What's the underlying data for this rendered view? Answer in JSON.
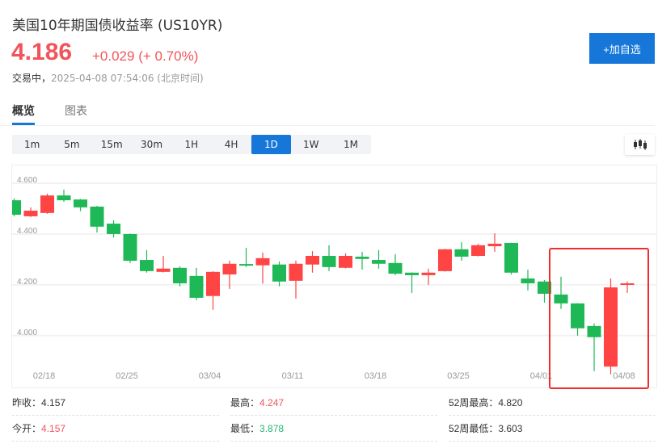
{
  "header": {
    "title": "美国10年期国债收益率  (US10YR)",
    "price": "4.186",
    "change": "+0.029 (+ 0.70%)",
    "status_label": "交易中，",
    "timestamp": "2025-04-08 07:54:06",
    "timezone": "(北京时间)",
    "add_watchlist_label": "+加自选"
  },
  "tabs": [
    {
      "label": "概览",
      "active": true
    },
    {
      "label": "图表",
      "active": false
    }
  ],
  "periods": [
    {
      "label": "1m"
    },
    {
      "label": "5m"
    },
    {
      "label": "15m"
    },
    {
      "label": "30m"
    },
    {
      "label": "1H"
    },
    {
      "label": "4H"
    },
    {
      "label": "1D",
      "active": true
    },
    {
      "label": "1W"
    },
    {
      "label": "1M"
    }
  ],
  "toolbar": {
    "chart_type_icon": "candlestick-icon"
  },
  "colors": {
    "up": "#ff4444",
    "down": "#1fb856",
    "accent": "#1677d9",
    "highlight": "#f22b2b"
  },
  "chart_data": {
    "type": "candlestick",
    "ylim": [
      3.85,
      4.67
    ],
    "y_ticks": [
      "4.600",
      "4.400",
      "4.200",
      "4.000"
    ],
    "x_ticks": [
      "02/18",
      "02/25",
      "03/04",
      "03/11",
      "03/18",
      "03/25",
      "04/01",
      "04/08"
    ],
    "grid": true,
    "candles": [
      {
        "date": "02/13",
        "o": 4.533,
        "h": 4.54,
        "l": 4.47,
        "c": 4.476
      },
      {
        "date": "02/14",
        "o": 4.47,
        "h": 4.505,
        "l": 4.467,
        "c": 4.492
      },
      {
        "date": "02/18",
        "o": 4.483,
        "h": 4.559,
        "l": 4.48,
        "c": 4.552
      },
      {
        "date": "02/19",
        "o": 4.552,
        "h": 4.575,
        "l": 4.527,
        "c": 4.533
      },
      {
        "date": "02/20",
        "o": 4.536,
        "h": 4.538,
        "l": 4.49,
        "c": 4.505
      },
      {
        "date": "02/21",
        "o": 4.508,
        "h": 4.511,
        "l": 4.406,
        "c": 4.429
      },
      {
        "date": "02/24",
        "o": 4.441,
        "h": 4.454,
        "l": 4.387,
        "c": 4.4
      },
      {
        "date": "02/25",
        "o": 4.4,
        "h": 4.402,
        "l": 4.286,
        "c": 4.295
      },
      {
        "date": "02/26",
        "o": 4.298,
        "h": 4.337,
        "l": 4.248,
        "c": 4.254
      },
      {
        "date": "02/27",
        "o": 4.251,
        "h": 4.314,
        "l": 4.249,
        "c": 4.264
      },
      {
        "date": "02/28",
        "o": 4.267,
        "h": 4.273,
        "l": 4.194,
        "c": 4.206
      },
      {
        "date": "03/03",
        "o": 4.235,
        "h": 4.267,
        "l": 4.14,
        "c": 4.149
      },
      {
        "date": "03/04",
        "o": 4.156,
        "h": 4.254,
        "l": 4.102,
        "c": 4.251
      },
      {
        "date": "03/05",
        "o": 4.241,
        "h": 4.295,
        "l": 4.184,
        "c": 4.283
      },
      {
        "date": "03/06",
        "o": 4.282,
        "h": 4.346,
        "l": 4.27,
        "c": 4.276
      },
      {
        "date": "03/07",
        "o": 4.277,
        "h": 4.327,
        "l": 4.205,
        "c": 4.305
      },
      {
        "date": "03/10",
        "o": 4.28,
        "h": 4.292,
        "l": 4.194,
        "c": 4.213
      },
      {
        "date": "03/11",
        "o": 4.216,
        "h": 4.295,
        "l": 4.146,
        "c": 4.283
      },
      {
        "date": "03/12",
        "o": 4.28,
        "h": 4.333,
        "l": 4.248,
        "c": 4.314
      },
      {
        "date": "03/13",
        "o": 4.314,
        "h": 4.356,
        "l": 4.254,
        "c": 4.27
      },
      {
        "date": "03/14",
        "o": 4.267,
        "h": 4.324,
        "l": 4.265,
        "c": 4.314
      },
      {
        "date": "03/17",
        "o": 4.311,
        "h": 4.33,
        "l": 4.26,
        "c": 4.302
      },
      {
        "date": "03/18",
        "o": 4.298,
        "h": 4.337,
        "l": 4.264,
        "c": 4.283
      },
      {
        "date": "03/19",
        "o": 4.286,
        "h": 4.321,
        "l": 4.238,
        "c": 4.244
      },
      {
        "date": "03/20",
        "o": 4.248,
        "h": 4.249,
        "l": 4.168,
        "c": 4.238
      },
      {
        "date": "03/21",
        "o": 4.238,
        "h": 4.264,
        "l": 4.2,
        "c": 4.248
      },
      {
        "date": "03/24",
        "o": 4.254,
        "h": 4.342,
        "l": 4.252,
        "c": 4.34
      },
      {
        "date": "03/25",
        "o": 4.34,
        "h": 4.368,
        "l": 4.295,
        "c": 4.311
      },
      {
        "date": "03/26",
        "o": 4.314,
        "h": 4.362,
        "l": 4.312,
        "c": 4.356
      },
      {
        "date": "03/27",
        "o": 4.352,
        "h": 4.403,
        "l": 4.33,
        "c": 4.362
      },
      {
        "date": "03/28",
        "o": 4.365,
        "h": 4.366,
        "l": 4.241,
        "c": 4.248
      },
      {
        "date": "03/31",
        "o": 4.225,
        "h": 4.26,
        "l": 4.178,
        "c": 4.206
      },
      {
        "date": "04/01",
        "o": 4.213,
        "h": 4.219,
        "l": 4.13,
        "c": 4.165
      },
      {
        "date": "04/02",
        "o": 4.162,
        "h": 4.232,
        "l": 4.105,
        "c": 4.127
      },
      {
        "date": "04/03",
        "o": 4.127,
        "h": 4.128,
        "l": 4.0,
        "c": 4.029
      },
      {
        "date": "04/04",
        "o": 4.038,
        "h": 4.048,
        "l": 3.86,
        "c": 3.994
      },
      {
        "date": "04/07",
        "o": 3.878,
        "h": 4.225,
        "l": 3.848,
        "c": 4.19
      },
      {
        "date": "04/08",
        "o": 4.2,
        "h": 4.213,
        "l": 4.168,
        "c": 4.206
      }
    ]
  },
  "stats": [
    [
      {
        "label": "昨收：",
        "value": "4.157",
        "tone": "v"
      },
      {
        "label": "最高：",
        "value": "4.247",
        "tone": "red"
      },
      {
        "label": "52周最高：",
        "value": "4.820",
        "tone": "v"
      }
    ],
    [
      {
        "label": "今开：",
        "value": "4.157",
        "tone": "red"
      },
      {
        "label": "最低：",
        "value": "3.878",
        "tone": "green"
      },
      {
        "label": "52周最低：",
        "value": "3.603",
        "tone": "v"
      }
    ]
  ]
}
